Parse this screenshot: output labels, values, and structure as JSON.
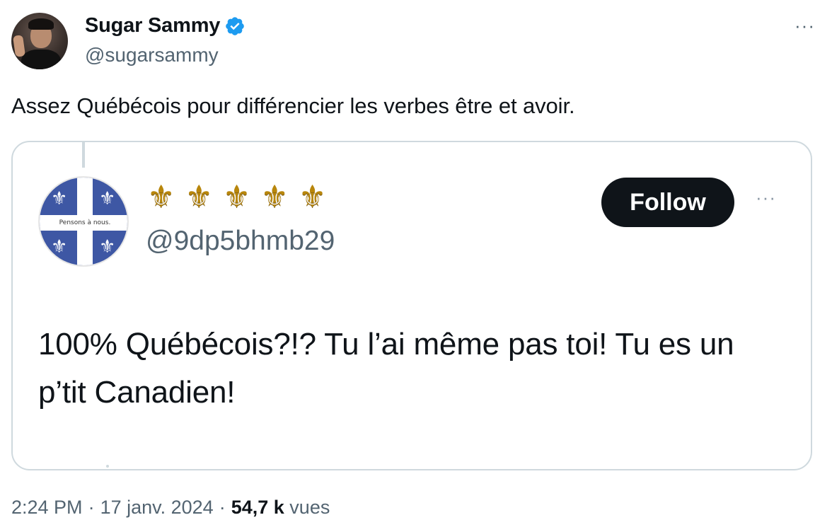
{
  "author": {
    "display_name": "Sugar Sammy",
    "handle": "@sugarsammy",
    "verified": true,
    "verified_color": "#1d9bf0"
  },
  "tweet": {
    "text": "Assez Québécois pour différencier les verbes être et avoir."
  },
  "quoted": {
    "display_name_icons": [
      "fleur-de-lis-icon",
      "fleur-de-lis-icon",
      "fleur-de-lis-icon",
      "fleur-de-lis-icon",
      "fleur-de-lis-icon"
    ],
    "handle": "@9dp5bhmb29",
    "avatar_motto": "Pensons à nous.",
    "follow_label": "Follow",
    "text": "100% Québécois?!? Tu l’ai même pas toi! Tu es un p’tit Canadien!"
  },
  "meta": {
    "time": "2:24 PM",
    "separator": "·",
    "date": "17 janv. 2024",
    "views_count": "54,7 k",
    "views_label": "vues"
  },
  "more_label": "···",
  "fleur_glyph": "⚜",
  "colors": {
    "text_primary": "#0f1419",
    "text_secondary": "#536471",
    "border": "#cfd9de",
    "follow_bg": "#0f1419",
    "quebec_blue": "#3e57a4",
    "gold": "#b8860b"
  }
}
